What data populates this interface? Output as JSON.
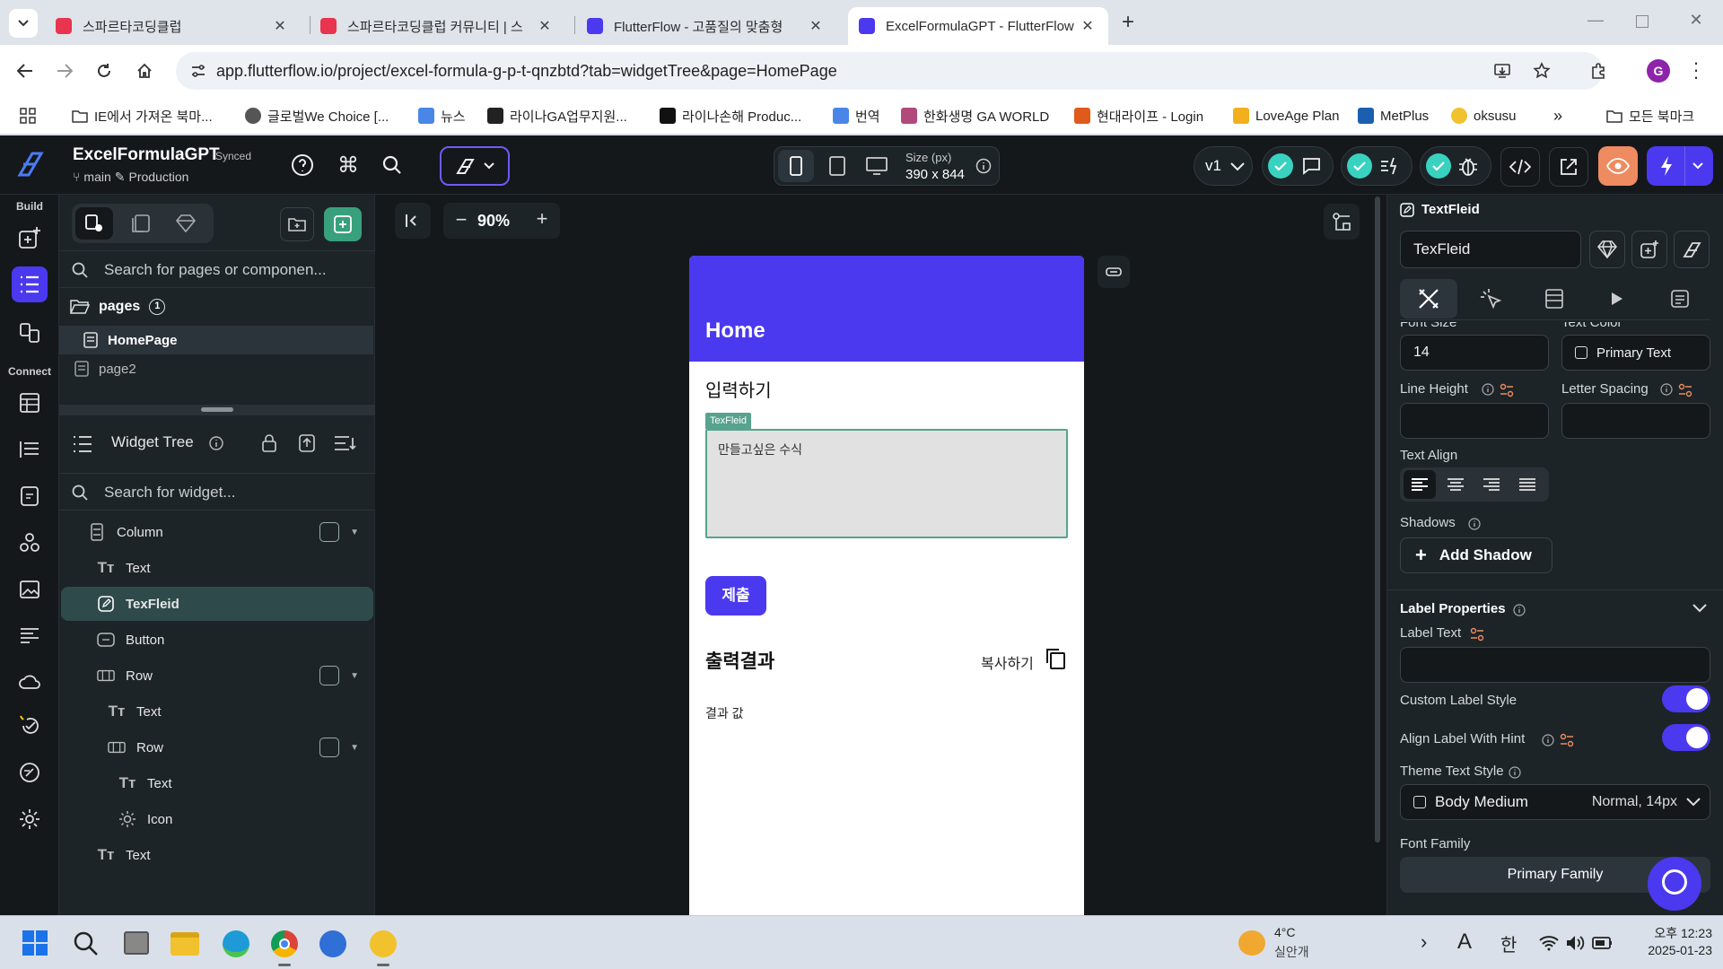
{
  "browser": {
    "tabs": [
      {
        "title": "스파르타코딩클럽",
        "active": false
      },
      {
        "title": "스파르타코딩클럽 커뮤니티 | 스",
        "active": false
      },
      {
        "title": "FlutterFlow - 고품질의 맞춤형",
        "active": false
      },
      {
        "title": "ExcelFormulaGPT - FlutterFlow",
        "active": true
      }
    ],
    "url": "app.flutterflow.io/project/excel-formula-g-p-t-qnzbtd?tab=widgetTree&page=HomePage",
    "profile_initial": "G",
    "bookmarks": [
      "IE에서 가져온 북마...",
      "글로벌We Choice [...",
      "뉴스",
      "라이나GA업무지원...",
      "라이나손해 Produc...",
      "번역",
      "한화생명 GA WORLD",
      "현대라이프 - Login",
      "LoveAge Plan",
      "MetPlus",
      "oksusu"
    ],
    "all_bookmarks": "모든 북마크"
  },
  "topbar": {
    "project_name": "ExcelFormulaGPT",
    "synced": "Synced",
    "branch": "main",
    "env": "Production",
    "size_label": "Size (px)",
    "size_value": "390 x 844",
    "version": "v1"
  },
  "rail": {
    "build_label": "Build",
    "connect_label": "Connect"
  },
  "leftpanel": {
    "search_pages_placeholder": "Search for pages or componen...",
    "pages_label": "pages",
    "pages_count": "1",
    "pages": [
      "HomePage",
      "page2"
    ],
    "widget_tree_title": "Widget Tree",
    "search_widget_placeholder": "Search for widget...",
    "tree": [
      {
        "label": "Column",
        "indent": 1
      },
      {
        "label": "Text",
        "indent": 2
      },
      {
        "label": "TexFleid",
        "indent": 2
      },
      {
        "label": "Button",
        "indent": 2
      },
      {
        "label": "Row",
        "indent": 2
      },
      {
        "label": "Text",
        "indent": 3
      },
      {
        "label": "Row",
        "indent": 3
      },
      {
        "label": "Text",
        "indent": 4
      },
      {
        "label": "Icon",
        "indent": 4
      },
      {
        "label": "Text",
        "indent": 2
      }
    ]
  },
  "canvas": {
    "zoom": "90%",
    "appbar_title": "Home",
    "input_heading": "입력하기",
    "textfield_tag": "TexFleid",
    "textfield_hint": "만들고싶은 수식",
    "submit_button": "제출",
    "output_heading": "출력결과",
    "copy_label": "복사하기",
    "result_text": "결과 값",
    "colors": {
      "primary": "#4b39ef",
      "selection": "#57a38e"
    }
  },
  "rightpanel": {
    "widget_type": "TextFleid",
    "widget_name": "TexFleid",
    "font_size_label": "Font Size",
    "font_size_value": "14",
    "text_color_label": "Text Color",
    "text_color_value": "Primary Text",
    "line_height_label": "Line Height",
    "letter_spacing_label": "Letter Spacing",
    "text_align_label": "Text Align",
    "shadows_label": "Shadows",
    "add_shadow": "Add Shadow",
    "label_properties": "Label Properties",
    "label_text": "Label Text",
    "custom_label_style": "Custom Label Style",
    "align_label_with_hint": "Align Label With Hint",
    "theme_text_style": "Theme Text Style",
    "theme_style_value": "Body Medium",
    "theme_style_meta": "Normal, 14px",
    "font_family_label": "Font Family",
    "font_family_value": "Primary Family"
  },
  "taskbar": {
    "weather_temp": "4°C",
    "weather_desc": "실안개",
    "ime_a": "A",
    "ime_han": "한",
    "time": "오후 12:23",
    "date": "2025-01-23"
  }
}
